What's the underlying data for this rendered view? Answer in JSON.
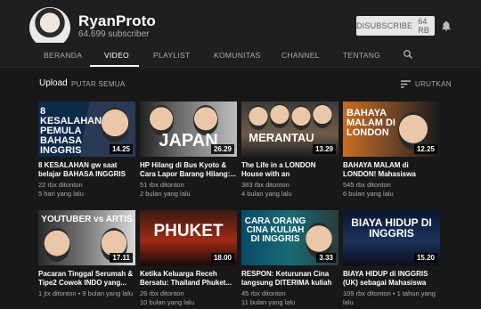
{
  "channel": {
    "name": "RyanProto",
    "subscribers": "64.699 subscriber",
    "subscribe_label": "DISUBSCRIBE",
    "subscribe_count": "64 RB"
  },
  "tabs": [
    {
      "label": "BERANDA"
    },
    {
      "label": "VIDEO"
    },
    {
      "label": "PLAYLIST"
    },
    {
      "label": "KOMUNITAS"
    },
    {
      "label": "CHANNEL"
    },
    {
      "label": "TENTANG"
    }
  ],
  "toolbar": {
    "upload": "Upload",
    "play_all": "PUTAR SEMUA",
    "sort": "URUTKAN"
  },
  "videos": [
    {
      "thumb_text": "8 KESALAHAN PEMULA BAHASA INGGRIS",
      "duration": "14.25",
      "title": "8 KESALAHAN gw saat belajar BAHASA INGGRIS -...",
      "views": "22 rbx ditonton",
      "age": "5 hari yang lalu"
    },
    {
      "thumb_text": "JAPAN",
      "duration": "26.29",
      "title": "HP Hilang di Bus Kyoto & Cara Lapor Barang Hilang:...",
      "views": "51 rbx ditonton",
      "age": "2 bulan yang lalu"
    },
    {
      "thumb_text": "MERANTAU",
      "duration": "13.29",
      "title": "The Life in a LONDON House with an INDONESIAN...",
      "views": "383 rbx ditonton",
      "age": "4 bulan yang lalu"
    },
    {
      "thumb_text": "BAHAYA MALAM DI LONDON",
      "duration": "12.25",
      "title": "BAHAYA MALAM di LONDON! Mahasiswa Ditodong PISTO...",
      "views": "545 rbx ditonton",
      "age": "6 bulan yang lalu"
    },
    {
      "thumb_text": "YOUTUBER vs ARTIS",
      "duration": "17.11",
      "title": "Pacaran Tinggal Serumah & Tipe2 Cowok INDO yang...",
      "views": "1 jtx ditonton",
      "age": "9 bulan yang lalu"
    },
    {
      "thumb_text": "PHUKET",
      "duration": "18.00",
      "title": "Ketika Keluarga Receh Bersatu: Thailand Phuket...",
      "views": "26 rbx ditonton",
      "age": "10 bulan yang lalu"
    },
    {
      "thumb_text": "CARA ORANG CINA KULIAH DI INGGRIS",
      "duration": "3.33",
      "title": "RESPON: Keturunan Cina langsung DITERIMA kuliah ...",
      "views": "45 rbx ditonton",
      "age": "11 bulan yang lalu"
    },
    {
      "thumb_text": "BIAYA HIDUP DI INGGRIS",
      "duration": "15.20",
      "title": "BIAYA HIDUP di INGGRIS (UK) sebagai Mahasiswa",
      "views": "109 rbx ditonton",
      "age": "1 tahun yang lalu"
    }
  ],
  "colors": {
    "background": "#181818",
    "header": "#1f1f1f",
    "subscribe_bg": "#e6e6e6"
  }
}
